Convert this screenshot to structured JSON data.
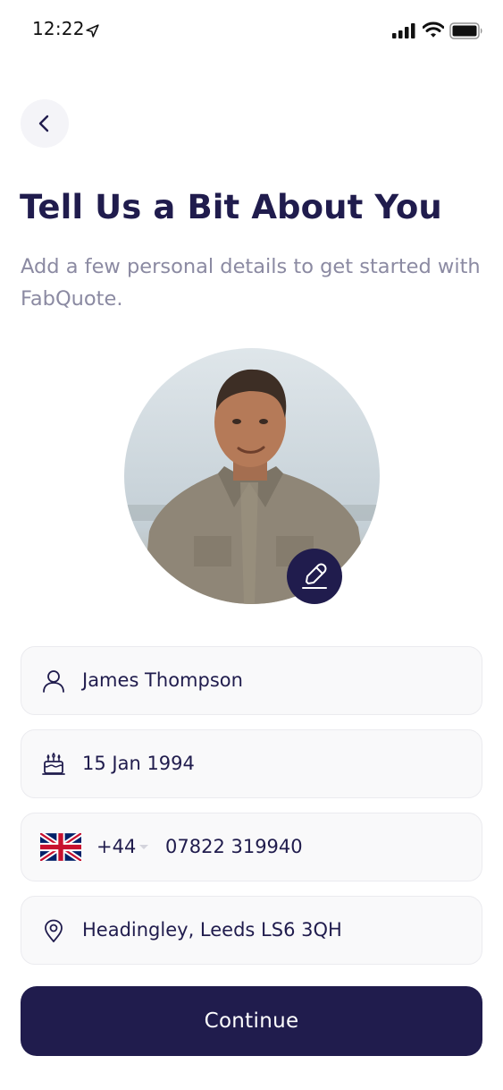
{
  "status_bar": {
    "time": "12:22",
    "icons": [
      "location-arrow-icon",
      "signal-icon",
      "wifi-icon",
      "battery-icon"
    ]
  },
  "header": {
    "back_icon": "chevron-left-icon",
    "title": "Tell Us a Bit About You",
    "subtitle": "Add a few personal details to get started with FabQuote."
  },
  "profile": {
    "avatar_image": "profile-photo",
    "edit_icon": "pencil-icon"
  },
  "form": {
    "name": {
      "icon": "user-icon",
      "value": "James Thompson"
    },
    "birthdate": {
      "icon": "birthday-cake-icon",
      "value": "15 Jan 1994"
    },
    "phone": {
      "flag_icon": "uk-flag-icon",
      "dial_code": "+44",
      "number": "07822 319940"
    },
    "address": {
      "icon": "location-pin-icon",
      "value": "Headingley, Leeds LS6 3QH"
    }
  },
  "actions": {
    "continue_label": "Continue"
  },
  "colors": {
    "primary": "#201c4d",
    "subtitle": "#8b8aa2",
    "field_bg": "#f9f9fa",
    "field_border": "#ebebef"
  }
}
